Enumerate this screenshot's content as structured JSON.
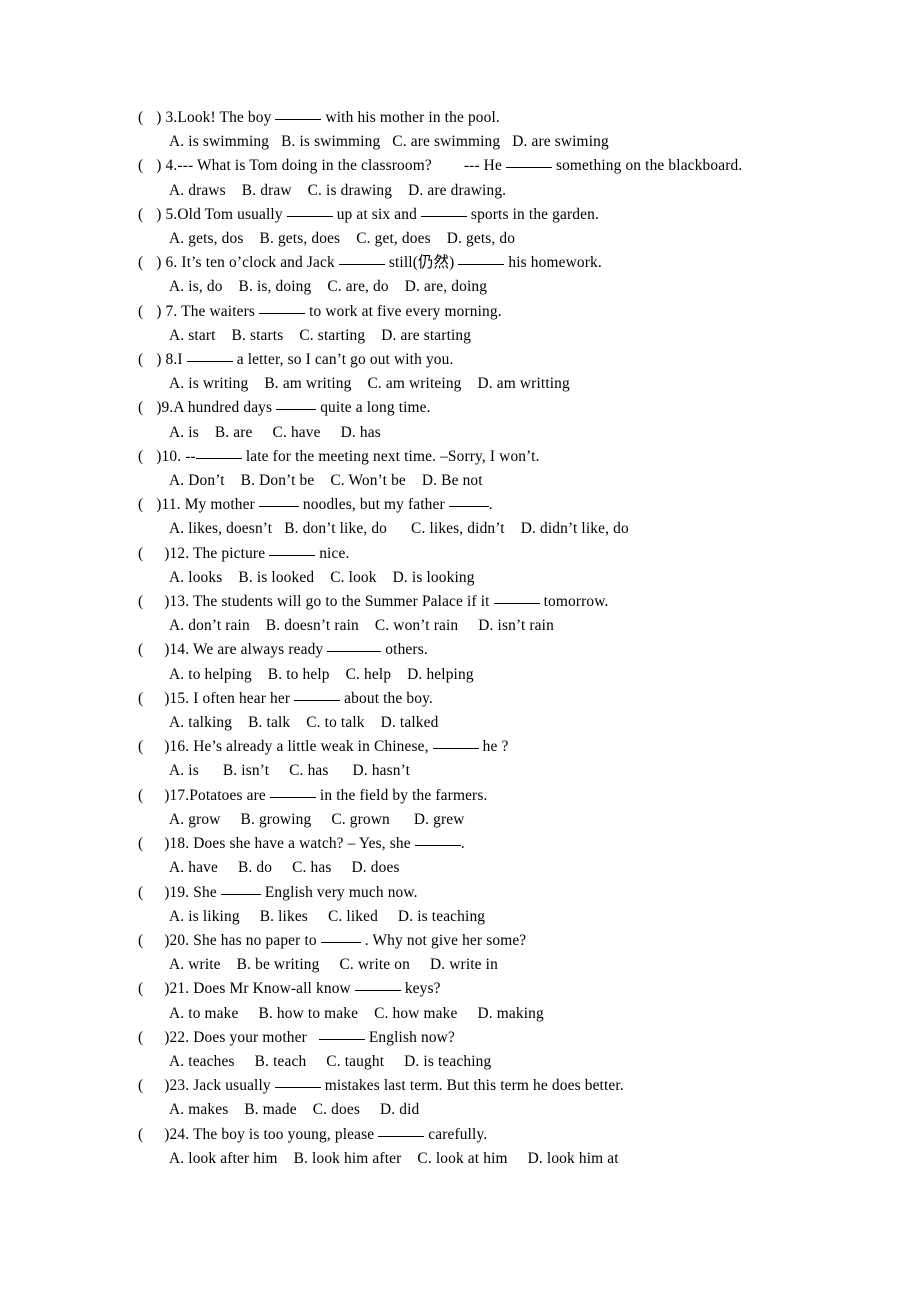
{
  "document": {
    "type": "grammar-multiple-choice-worksheet",
    "language": "English with Chinese gloss",
    "background_color": "#ffffff",
    "text_color": "#000000",
    "blank_marker": "______",
    "checkbox_marker": "(  )"
  },
  "questions": [
    {
      "number": "3",
      "gap": "narrow",
      "stem_before": ") 3.Look! The boy ",
      "blank": "b-m",
      "stem_after": " with his mother in the pool.",
      "options": "A. is swimming   B. is swimming   C. are swimming   D. are swiming"
    },
    {
      "number": "4",
      "gap": "narrow",
      "stem_before": ") 4.--- What is Tom doing in the classroom?        --- He ",
      "blank": "b-m",
      "stem_after": " something on the blackboard.",
      "options": "A. draws    B. draw    C. is drawing    D. are drawing."
    },
    {
      "number": "5",
      "gap": "narrow",
      "stem_before": ") 5.Old Tom usually ",
      "blank": "b-m",
      "stem_mid": " up at six and ",
      "blank2": "b-m",
      "stem_after": " sports in the garden.",
      "options": "A. gets, dos    B. gets, does    C. get, does    D. gets, do"
    },
    {
      "number": "6",
      "gap": "narrow",
      "stem_before": ") 6. It’s ten o’clock and Jack ",
      "blank": "b-m",
      "stem_mid": " still(仍然) ",
      "blank2": "b-m",
      "stem_after": " his homework.",
      "options": "A. is, do    B. is, doing    C. are, do    D. are, doing"
    },
    {
      "number": "7",
      "gap": "narrow",
      "stem_before": ") 7. The waiters ",
      "blank": "b-m",
      "stem_after": " to work at five every morning.",
      "options": "A. start    B. starts    C. starting    D. are starting"
    },
    {
      "number": "8",
      "gap": "narrow",
      "stem_before": ") 8.I ",
      "blank": "b-m",
      "stem_after": " a letter, so I can’t go out with you.",
      "options": "A. is writing    B. am writing    C. am writeing    D. am writting"
    },
    {
      "number": "9",
      "gap": "narrow",
      "stem_before": ")9.A hundred days ",
      "blank": "b-s",
      "stem_after": " quite a long time.",
      "options": "A. is    B. are     C. have     D. has"
    },
    {
      "number": "10",
      "gap": "narrow",
      "stem_before": ")10. --",
      "blank": "b-m",
      "stem_after": " late for the meeting next time. –Sorry, I won’t.",
      "options": "A. Don’t    B. Don’t be    C. Won’t be    D. Be not"
    },
    {
      "number": "11",
      "gap": "narrow",
      "stem_before": ")11. My mother ",
      "blank": "b-s",
      "stem_mid": " noodles, but my father ",
      "blank2": "b-s",
      "stem_after": ".",
      "options": "A. likes, doesn’t   B. don’t like, do      C. likes, didn’t    D. didn’t like, do"
    },
    {
      "number": "12",
      "gap": "wide",
      "stem_before": ")12. The picture ",
      "blank": "b-m",
      "stem_after": " nice.",
      "options": "A. looks    B. is looked    C. look    D. is looking"
    },
    {
      "number": "13",
      "gap": "wide",
      "stem_before": ")13. The students will go to the Summer Palace if it ",
      "blank": "b-m",
      "stem_after": " tomorrow.",
      "options": "A. don’t rain    B. doesn’t rain    C. won’t rain     D. isn’t rain"
    },
    {
      "number": "14",
      "gap": "wide",
      "stem_before": ")14. We are always ready ",
      "blank": "b-l",
      "stem_after": " others.",
      "options": "A. to helping    B. to help    C. help    D. helping"
    },
    {
      "number": "15",
      "gap": "wide",
      "stem_before": ")15. I often hear her ",
      "blank": "b-m",
      "stem_after": " about the boy.",
      "options": "A. talking    B. talk    C. to talk    D. talked"
    },
    {
      "number": "16",
      "gap": "wide",
      "stem_before": ")16. He’s already a little weak in Chinese, ",
      "blank": "b-m",
      "stem_after": " he ?",
      "options": "A. is      B. isn’t     C. has      D. hasn’t"
    },
    {
      "number": "17",
      "gap": "wide",
      "stem_before": ")17.Potatoes are ",
      "blank": "b-m",
      "stem_after": " in the field by the farmers.",
      "options": "A. grow     B. growing     C. grown      D. grew"
    },
    {
      "number": "18",
      "gap": "wide",
      "stem_before": ")18. Does she have a watch? – Yes, she ",
      "blank": "b-m",
      "stem_after": ".",
      "options": "A. have     B. do     C. has     D. does"
    },
    {
      "number": "19",
      "gap": "wide",
      "stem_before": ")19. She ",
      "blank": "b-s",
      "stem_after": " English very much now.",
      "options": "A. is liking     B. likes     C. liked     D. is teaching"
    },
    {
      "number": "20",
      "gap": "wide",
      "stem_before": ")20. She has no paper to ",
      "blank": "b-s",
      "stem_after": " . Why not give her some?",
      "options": "A. write    B. be writing     C. write on     D. write in"
    },
    {
      "number": "21",
      "gap": "wide",
      "stem_before": ")21. Does Mr Know-all know ",
      "blank": "b-m",
      "stem_after": " keys?",
      "options": "A. to make     B. how to make    C. how make     D. making"
    },
    {
      "number": "22",
      "gap": "wide",
      "stem_before": ")22. Does your mother   ",
      "blank": "b-m",
      "stem_after": " English now?",
      "options": "A. teaches     B. teach     C. taught     D. is teaching"
    },
    {
      "number": "23",
      "gap": "wide",
      "stem_before": ")23. Jack usually ",
      "blank": "b-m",
      "stem_after": " mistakes last term. But this term he does better.",
      "options": "A. makes    B. made    C. does     D. did"
    },
    {
      "number": "24",
      "gap": "wide",
      "stem_before": ")24. The boy is too young, please ",
      "blank": "b-m",
      "stem_after": " carefully.",
      "options": "A. look after him    B. look him after    C. look at him     D. look him at"
    }
  ]
}
